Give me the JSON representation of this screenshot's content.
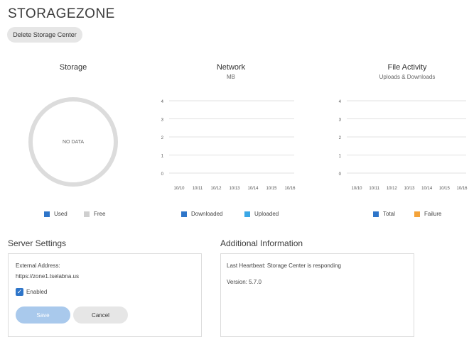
{
  "page": {
    "title": "STORAGEZONE",
    "delete_button": "Delete Storage Center"
  },
  "storage": {
    "title": "Storage",
    "no_data": "NO DATA",
    "legend": [
      {
        "label": "Used",
        "color": "#2e75c9"
      },
      {
        "label": "Free",
        "color": "#cfcfcf"
      }
    ]
  },
  "network": {
    "title": "Network",
    "subtitle": "MB",
    "legend": [
      {
        "label": "Downloaded",
        "color": "#2e75c9"
      },
      {
        "label": "Uploaded",
        "color": "#3aa7e6"
      }
    ]
  },
  "file_activity": {
    "title": "File Activity",
    "subtitle": "Uploads & Downloads",
    "legend": [
      {
        "label": "Total",
        "color": "#2e75c9"
      },
      {
        "label": "Failure",
        "color": "#f4a33a"
      }
    ]
  },
  "chart_data": [
    {
      "type": "pie",
      "title": "Storage",
      "categories": [
        "Used",
        "Free"
      ],
      "values": [],
      "annotation": "NO DATA"
    },
    {
      "type": "line",
      "title": "Network",
      "subtitle": "MB",
      "x": [
        "10/10",
        "10/11",
        "10/12",
        "10/13",
        "10/14",
        "10/15",
        "10/16"
      ],
      "yticks": [
        0,
        1,
        2,
        3,
        4
      ],
      "ylim": [
        0,
        4
      ],
      "series": [
        {
          "name": "Downloaded",
          "values": []
        },
        {
          "name": "Uploaded",
          "values": []
        }
      ]
    },
    {
      "type": "line",
      "title": "File Activity",
      "subtitle": "Uploads & Downloads",
      "x": [
        "10/10",
        "10/11",
        "10/12",
        "10/13",
        "10/14",
        "10/15",
        "10/16"
      ],
      "yticks": [
        0,
        1,
        2,
        3,
        4
      ],
      "ylim": [
        0,
        4
      ],
      "series": [
        {
          "name": "Total",
          "values": []
        },
        {
          "name": "Failure",
          "values": []
        }
      ]
    }
  ],
  "server_settings": {
    "title": "Server Settings",
    "external_address_label": "External Address:",
    "external_address_value": "https://zone1.tselabna.us",
    "enabled_label": "Enabled",
    "enabled": true,
    "save_label": "Save",
    "cancel_label": "Cancel"
  },
  "additional_info": {
    "title": "Additional Information",
    "heartbeat": "Last Heartbeat: Storage Center is responding",
    "version": "Version: 5.7.0"
  }
}
